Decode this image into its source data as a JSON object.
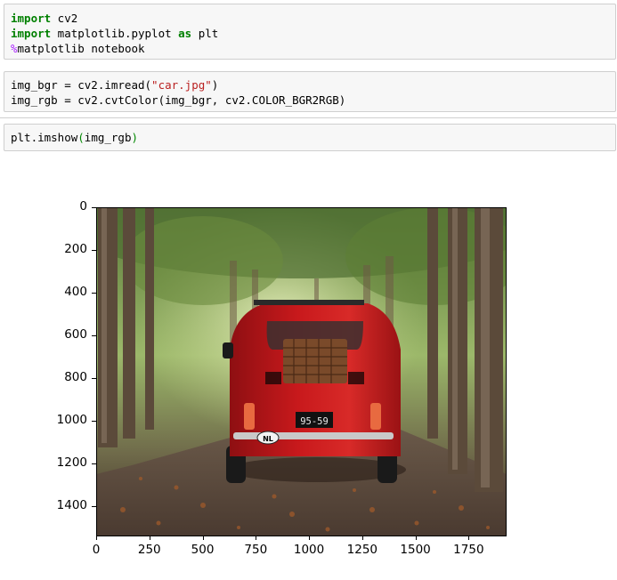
{
  "cells": [
    {
      "lines": [
        [
          {
            "t": "import",
            "c": "kw"
          },
          {
            "t": " cv2",
            "c": ""
          }
        ],
        [
          {
            "t": "import",
            "c": "kw"
          },
          {
            "t": " matplotlib.pyplot ",
            "c": ""
          },
          {
            "t": "as",
            "c": "kw"
          },
          {
            "t": " plt",
            "c": ""
          }
        ],
        [
          {
            "t": "%",
            "c": "mag"
          },
          {
            "t": "matplotlib notebook",
            "c": ""
          }
        ]
      ]
    },
    {
      "lines": [
        [
          {
            "t": "img_bgr = cv2.imread(",
            "c": ""
          },
          {
            "t": "\"car.jpg\"",
            "c": "str"
          },
          {
            "t": ")",
            "c": ""
          }
        ],
        [
          {
            "t": "img_rgb = cv2.cvtColor(img_bgr, cv2.COLOR_BGR2RGB)",
            "c": ""
          }
        ]
      ]
    },
    {
      "lines": [
        [
          {
            "t": "plt.imshow",
            "c": ""
          },
          {
            "t": "(",
            "c": "paren"
          },
          {
            "t": "img_rgb",
            "c": ""
          },
          {
            "t": ")",
            "c": "paren"
          }
        ]
      ]
    }
  ],
  "output": {
    "image": {
      "description": "red vintage car on tree-lined road",
      "plate_text": "95-59",
      "badge_text": "NL"
    },
    "x_axis": {
      "ticks": [
        "0",
        "250",
        "500",
        "750",
        "1000",
        "1250",
        "1500",
        "1750"
      ],
      "tick_values": [
        0,
        250,
        500,
        750,
        1000,
        1250,
        1500,
        1750
      ],
      "xlim": [
        0,
        1920
      ]
    },
    "y_axis": {
      "ticks": [
        "0",
        "200",
        "400",
        "600",
        "800",
        "1000",
        "1200",
        "1400"
      ],
      "tick_values": [
        0,
        200,
        400,
        600,
        800,
        1000,
        1200,
        1400
      ],
      "ylim": [
        1535,
        0
      ]
    }
  }
}
